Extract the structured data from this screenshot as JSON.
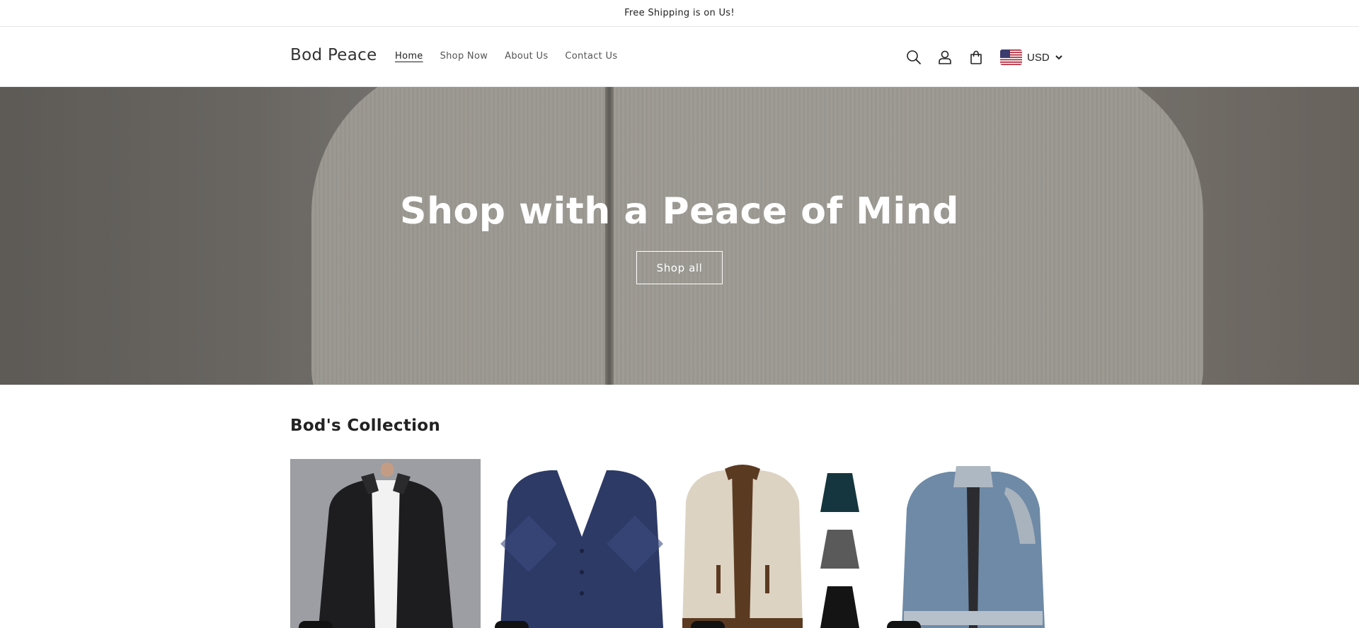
{
  "announcement": {
    "text": "Free Shipping is on Us!"
  },
  "header": {
    "logo": "Bod Peace",
    "nav": [
      {
        "label": "Home",
        "active": true
      },
      {
        "label": "Shop Now",
        "active": false
      },
      {
        "label": "About Us",
        "active": false
      },
      {
        "label": "Contact Us",
        "active": false
      }
    ],
    "icons": [
      "search-icon",
      "account-icon",
      "cart-icon"
    ],
    "currency": {
      "code": "USD",
      "flag": "us-flag-icon"
    }
  },
  "hero": {
    "title": "Shop with a Peace of Mind",
    "button_label": "Shop all"
  },
  "collection": {
    "title": "Bod's Collection",
    "products": [
      {
        "image": "black-puffer-knit-jacket"
      },
      {
        "image": "navy-argyle-cardigan"
      },
      {
        "image": "beige-deer-zip-cardigan"
      },
      {
        "image": "blue-melange-zip-cardigan"
      }
    ]
  },
  "colors": {
    "text": "#121212",
    "border": "#e5e5e5",
    "hero_text": "#ffffff"
  }
}
